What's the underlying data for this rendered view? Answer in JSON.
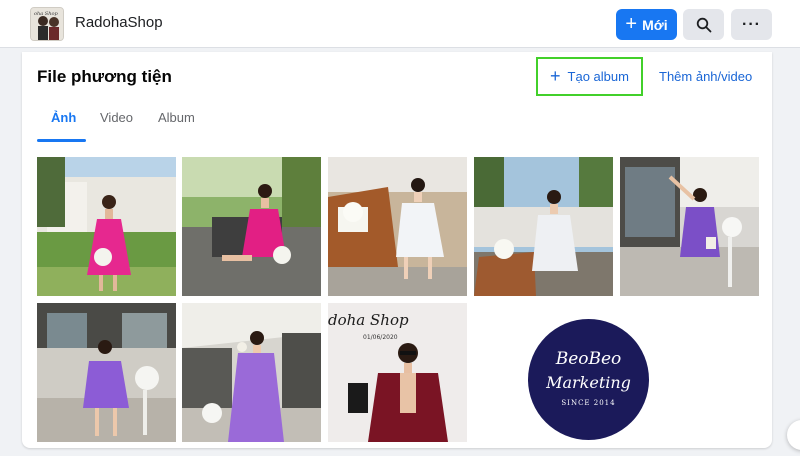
{
  "header": {
    "page_name": "RadohaShop",
    "new_button_label": "Mới",
    "plus_glyph": "+",
    "more_glyph": "···",
    "search_icon": "search-icon",
    "more_icon": "more-icon"
  },
  "media": {
    "title": "File phương tiện",
    "create_album_label": "Tạo album",
    "add_media_label": "Thêm ảnh/video",
    "tabs": [
      {
        "label": "Ảnh",
        "active": true
      },
      {
        "label": "Video",
        "active": false
      },
      {
        "label": "Album",
        "active": false
      }
    ],
    "photos": [
      {
        "name": "photo-1",
        "dress_color": "#e6288f"
      },
      {
        "name": "photo-2",
        "dress_color": "#e21f84"
      },
      {
        "name": "photo-3",
        "dress_color": "#f2f4f7"
      },
      {
        "name": "photo-4",
        "dress_color": "#eef0f3"
      },
      {
        "name": "photo-5",
        "dress_color": "#7b4fc7"
      },
      {
        "name": "photo-6",
        "dress_color": "#8c5cd6"
      },
      {
        "name": "photo-7",
        "dress_color": "#9a6ad8"
      },
      {
        "name": "photo-8",
        "dress_color": "#7a1424",
        "text": [
          "doha Shop",
          "01/06/2020"
        ]
      }
    ],
    "watermark": {
      "line1": "BeoBeo",
      "line2": "Marketing",
      "line3": "SINCE 2014"
    }
  },
  "colors": {
    "accent": "#1877f2",
    "highlight_box": "#42d02a",
    "watermark_bg": "#1b1a5a"
  }
}
